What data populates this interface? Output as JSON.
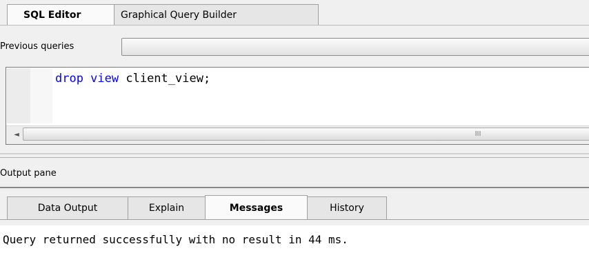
{
  "editor_tabs": [
    "SQL Editor",
    "Graphical Query Builder"
  ],
  "previous_queries": {
    "label": "Previous queries",
    "value": ""
  },
  "editor": {
    "code_keyword": "drop view",
    "code_rest": " client_view;"
  },
  "scrollbar": {
    "left_arrow": "◄",
    "grip": "III"
  },
  "output_pane": {
    "title": "Output pane",
    "tabs": [
      "Data Output",
      "Explain",
      "Messages",
      "History"
    ],
    "active_tab": "Messages",
    "message": "Query returned successfully with no result in 44 ms."
  }
}
